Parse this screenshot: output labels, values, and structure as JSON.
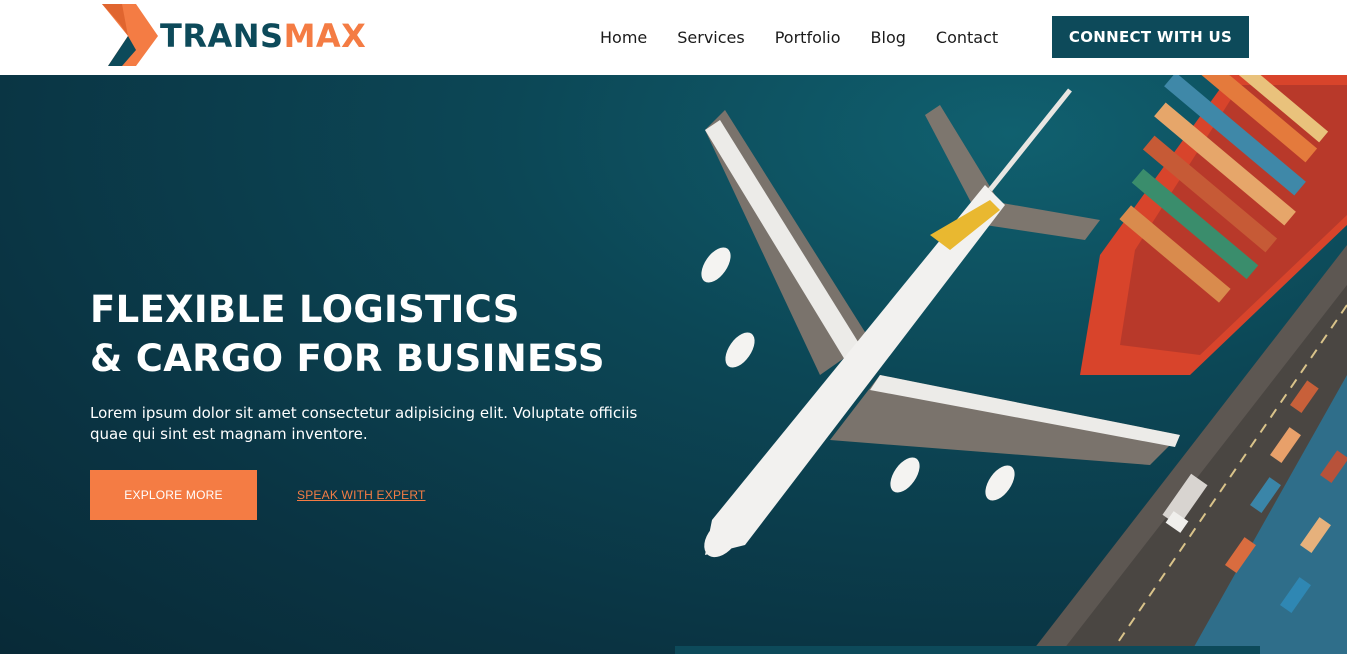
{
  "brand": {
    "name_part1": "TRANS",
    "name_part2": "MAX",
    "logo_icon": "chevron-logo-icon",
    "colors": {
      "primary": "#0d4a5a",
      "accent": "#f47c44"
    }
  },
  "nav": {
    "items": [
      {
        "label": "Home"
      },
      {
        "label": "Services"
      },
      {
        "label": "Portfolio"
      },
      {
        "label": "Blog"
      },
      {
        "label": "Contact"
      }
    ],
    "cta_label": "CONNECT WITH US"
  },
  "hero": {
    "title_line1": "FLEXIBLE LOGISTICS",
    "title_line2": "& CARGO FOR BUSINESS",
    "subtitle": "Lorem ipsum dolor sit amet consectetur adipisicing elit. Voluptate officiis quae qui sint est magnam inventore.",
    "primary_button": "EXPLORE MORE",
    "secondary_link": "SPEAK WITH EXPERT"
  }
}
